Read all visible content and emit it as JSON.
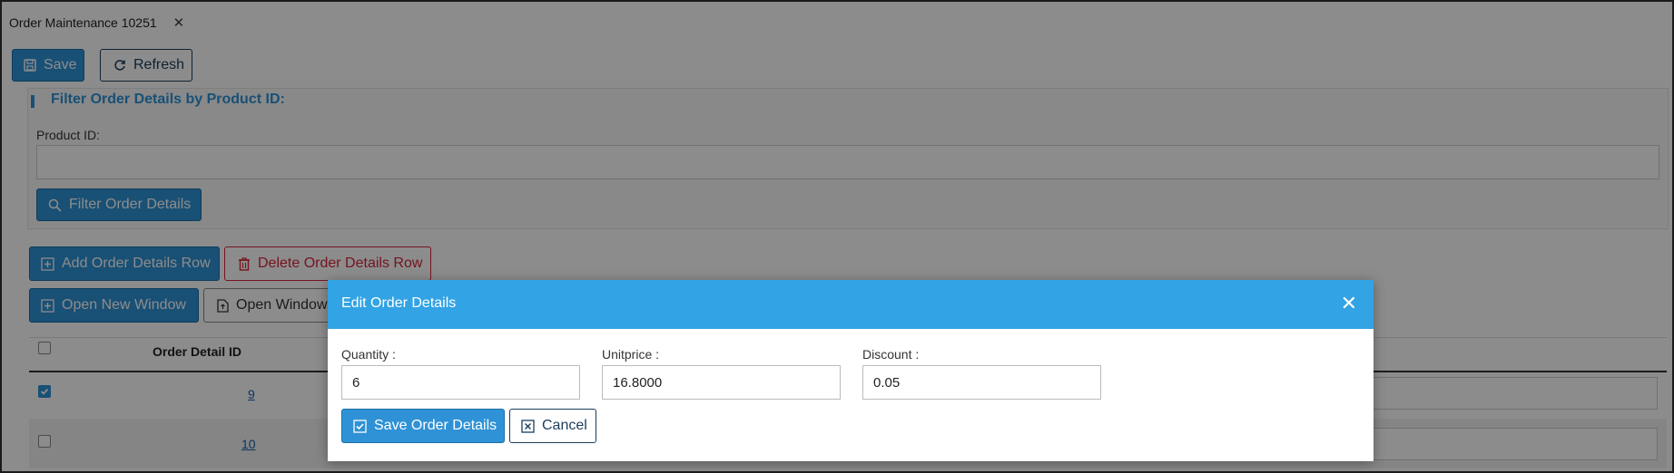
{
  "tab": {
    "title": "Order Maintenance 10251",
    "close": "✕"
  },
  "toolbar": {
    "save_label": "Save",
    "refresh_label": "Refresh"
  },
  "filter": {
    "title": "Filter Order Details by Product ID:",
    "product_label": "Product ID:",
    "product_value": "",
    "button_label": "Filter Order Details"
  },
  "actions": {
    "add_row": "Add Order Details Row",
    "delete_row": "Delete Order Details Row",
    "open_new_window": "Open New Window",
    "open_window": "Open Window"
  },
  "grid": {
    "col_id_header": "Order Detail ID",
    "rows": [
      {
        "id": "9",
        "checked": true
      },
      {
        "id": "10",
        "checked": false
      }
    ]
  },
  "modal": {
    "title": "Edit Order Details",
    "close": "✕",
    "fields": {
      "quantity": {
        "label": "Quantity :",
        "value": "6"
      },
      "unitprice": {
        "label": "Unitprice :",
        "value": "16.8000"
      },
      "discount": {
        "label": "Discount :",
        "value": "0.05"
      }
    },
    "save_label": "Save Order Details",
    "cancel_label": "Cancel"
  },
  "colors": {
    "accent": "#32a3e4",
    "primary": "#2f92d6",
    "danger": "#d8233a"
  }
}
